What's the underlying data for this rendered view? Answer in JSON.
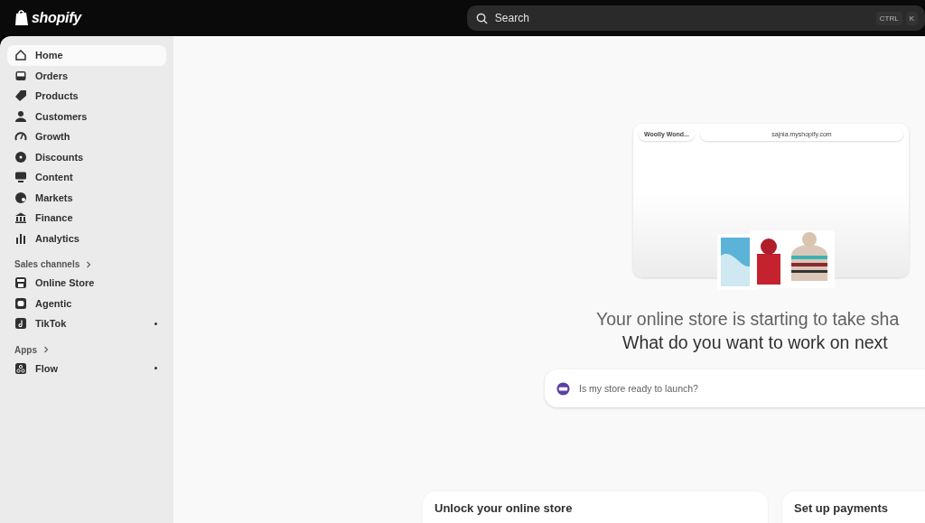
{
  "topbar": {
    "logo": "shopify",
    "search": {
      "placeholder": "Search",
      "shortcut": [
        "CTRL",
        "K"
      ]
    }
  },
  "sidebar": {
    "items": [
      {
        "label": "Home",
        "selected": true
      },
      {
        "label": "Orders",
        "selected": false
      },
      {
        "label": "Products",
        "selected": false
      },
      {
        "label": "Customers",
        "selected": false
      },
      {
        "label": "Growth",
        "selected": false
      },
      {
        "label": "Discounts",
        "selected": false
      },
      {
        "label": "Content",
        "selected": false
      },
      {
        "label": "Markets",
        "selected": false
      },
      {
        "label": "Finance",
        "selected": false
      },
      {
        "label": "Analytics",
        "selected": false
      }
    ],
    "sections": [
      {
        "title": "Sales channels",
        "items": [
          {
            "label": "Online Store",
            "dot": false
          },
          {
            "label": "Agentic",
            "dot": false
          },
          {
            "label": "TikTok",
            "dot": true
          }
        ]
      },
      {
        "title": "Apps",
        "items": [
          {
            "label": "Flow",
            "dot": true
          }
        ]
      }
    ]
  },
  "preview": {
    "store_name": "Woolly Wond...",
    "url": "sajnia.myshopify.com"
  },
  "headline": "Your online store is starting to take sha",
  "subheadline": "What do you want to work on next",
  "prompt": {
    "placeholder": "Is my store ready to launch?"
  },
  "cards": [
    {
      "title": "Unlock your online store"
    },
    {
      "title": "Set up payments"
    }
  ]
}
